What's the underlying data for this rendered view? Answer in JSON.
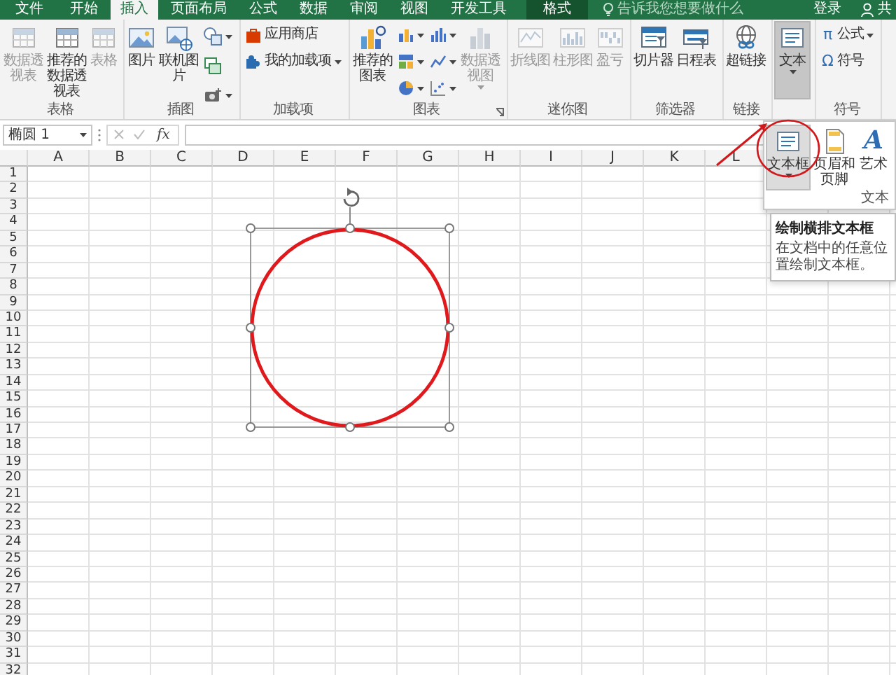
{
  "tabs": [
    {
      "label": "文件",
      "kind": "file",
      "selected": false
    },
    {
      "label": "开始",
      "kind": "normal",
      "selected": false
    },
    {
      "label": "插入",
      "kind": "normal",
      "selected": true
    },
    {
      "label": "页面布局",
      "kind": "normal",
      "selected": false
    },
    {
      "label": "公式",
      "kind": "normal",
      "selected": false
    },
    {
      "label": "数据",
      "kind": "normal",
      "selected": false
    },
    {
      "label": "审阅",
      "kind": "normal",
      "selected": false
    },
    {
      "label": "视图",
      "kind": "normal",
      "selected": false
    },
    {
      "label": "开发工具",
      "kind": "normal",
      "selected": false
    },
    {
      "label": "格式",
      "kind": "contextual",
      "selected": false
    }
  ],
  "tell_me": {
    "placeholder": "告诉我您想要做什么"
  },
  "account": {
    "sign_in": "登录",
    "share": "共"
  },
  "ribbon": {
    "groups": [
      {
        "label": "表格",
        "launcher": false,
        "buttons": [
          {
            "kind": "large",
            "label": "数据透视表",
            "disabled": true,
            "pressed": false,
            "dropdown": false
          },
          {
            "kind": "large",
            "label": "推荐的数据透视表",
            "disabled": false,
            "pressed": false,
            "dropdown": false
          },
          {
            "kind": "large",
            "label": "表格",
            "disabled": true,
            "pressed": false,
            "dropdown": false
          }
        ]
      },
      {
        "label": "插图",
        "launcher": false,
        "buttons": [
          {
            "kind": "large",
            "label": "图片",
            "disabled": false,
            "pressed": false,
            "dropdown": false
          },
          {
            "kind": "large",
            "label": "联机图片",
            "disabled": false,
            "pressed": false,
            "dropdown": false
          },
          {
            "kind": "stack",
            "items": [
              {
                "dropdown": true
              },
              {
                "dropdown": false
              },
              {
                "dropdown": true
              }
            ]
          }
        ]
      },
      {
        "label": "加载项",
        "launcher": false,
        "buttons": [
          {
            "kind": "stack",
            "items": [
              {
                "label": "应用商店",
                "dropdown": false
              },
              {
                "label": "我的加载项",
                "dropdown": true
              }
            ]
          }
        ]
      },
      {
        "label": "图表",
        "launcher": true,
        "buttons": [
          {
            "kind": "large",
            "label": "推荐的图表",
            "disabled": false,
            "pressed": false,
            "dropdown": false
          },
          {
            "kind": "stack",
            "items": [
              {
                "dropdown": true
              },
              {
                "dropdown": true
              },
              {
                "dropdown": true
              }
            ]
          },
          {
            "kind": "stack",
            "items": [
              {
                "dropdown": true
              },
              {
                "dropdown": true
              },
              {
                "dropdown": true
              }
            ]
          },
          {
            "kind": "large",
            "label": "数据透视图",
            "disabled": true,
            "pressed": false,
            "dropdown": true
          }
        ]
      },
      {
        "label": "迷你图",
        "launcher": false,
        "buttons": [
          {
            "kind": "large",
            "label": "折线图",
            "disabled": true,
            "pressed": false,
            "dropdown": false
          },
          {
            "kind": "large",
            "label": "柱形图",
            "disabled": true,
            "pressed": false,
            "dropdown": false
          },
          {
            "kind": "large",
            "label": "盈亏",
            "disabled": true,
            "pressed": false,
            "dropdown": false
          }
        ]
      },
      {
        "label": "筛选器",
        "launcher": false,
        "buttons": [
          {
            "kind": "large",
            "label": "切片器",
            "disabled": false,
            "pressed": false,
            "dropdown": false
          },
          {
            "kind": "large",
            "label": "日程表",
            "disabled": false,
            "pressed": false,
            "dropdown": false
          }
        ]
      },
      {
        "label": "链接",
        "launcher": false,
        "buttons": [
          {
            "kind": "large",
            "label": "超链接",
            "disabled": false,
            "pressed": false,
            "dropdown": false
          }
        ]
      },
      {
        "launcher": false,
        "buttons": [
          {
            "kind": "large",
            "label": "文本",
            "disabled": false,
            "pressed": true,
            "dropdown": true
          }
        ]
      },
      {
        "label": "符号",
        "launcher": false,
        "buttons": [
          {
            "kind": "stack",
            "items": [
              {
                "glyph": "π",
                "label": "公式",
                "dropdown": true
              },
              {
                "glyph": "Ω",
                "label": "符号",
                "dropdown": false
              }
            ]
          }
        ]
      }
    ]
  },
  "formula_bar": {
    "name_box": "椭圆 1",
    "function_label": "fx"
  },
  "sheet": {
    "columns": [
      "A",
      "B",
      "C",
      "D",
      "E",
      "F",
      "G",
      "H",
      "I",
      "J",
      "K",
      "L"
    ],
    "rows": [
      "1",
      "2",
      "3",
      "4",
      "5",
      "6",
      "7",
      "8",
      "9",
      "10",
      "11",
      "12",
      "13",
      "14",
      "15",
      "16",
      "17",
      "18",
      "19",
      "20",
      "21",
      "22",
      "23",
      "24",
      "25",
      "26",
      "27",
      "28",
      "29",
      "30",
      "31",
      "32"
    ],
    "shape": {
      "kind": "ellipse",
      "selected": true
    }
  },
  "gallery": {
    "label": "文本",
    "items": [
      {
        "label": "文本框",
        "selected": true,
        "dropdown": true
      },
      {
        "label": "页眉和页脚",
        "selected": false,
        "dropdown": false
      },
      {
        "label": "艺术",
        "glyph": "A",
        "selected": false,
        "dropdown": false
      }
    ]
  },
  "tooltip": {
    "title": "绘制横排文本框",
    "body": "在文档中的任意位置绘制文本框。"
  }
}
